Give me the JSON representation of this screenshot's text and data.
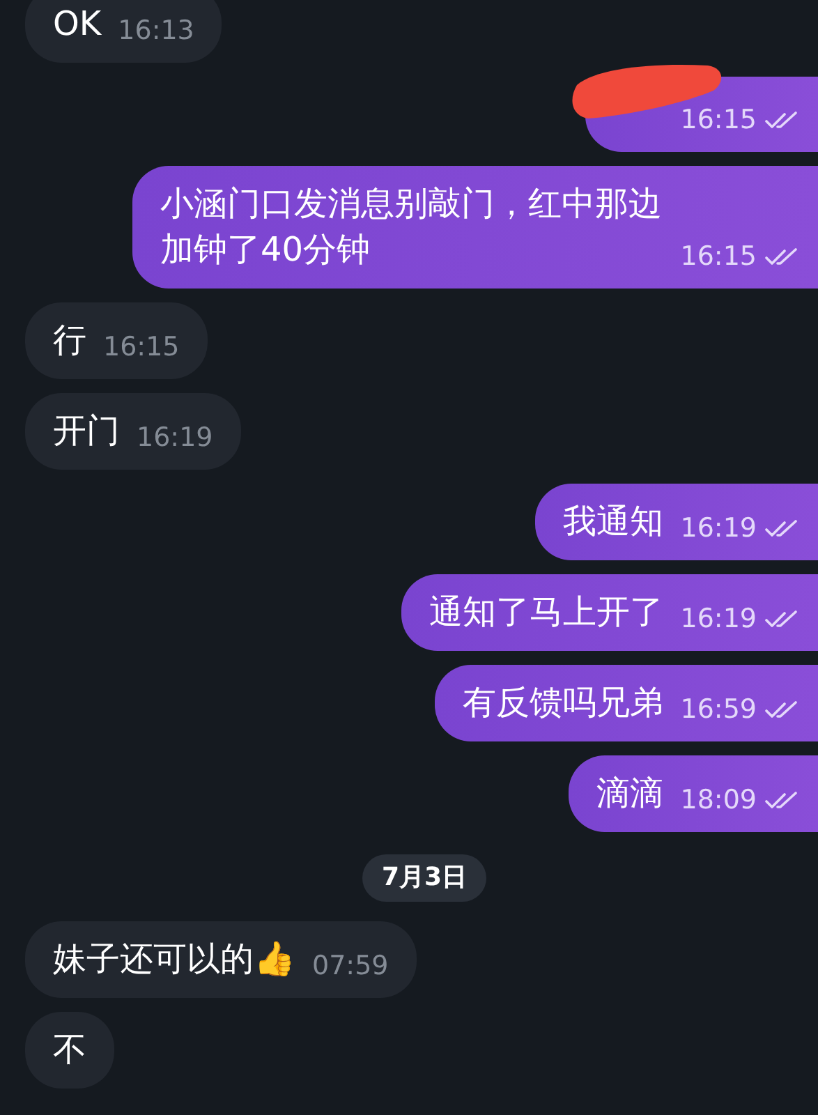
{
  "messages": [
    {
      "kind": "message",
      "outgoing": false,
      "text": "OK",
      "time": "16:13"
    },
    {
      "kind": "redacted",
      "outgoing": true,
      "time": "16:15",
      "read": true
    },
    {
      "kind": "message",
      "outgoing": true,
      "text": "小涵门口发消息别敲门，红中那边加钟了40分钟",
      "time": "16:15",
      "read": true
    },
    {
      "kind": "message",
      "outgoing": false,
      "text": "行",
      "time": "16:15"
    },
    {
      "kind": "message",
      "outgoing": false,
      "text": "开门",
      "time": "16:19"
    },
    {
      "kind": "message",
      "outgoing": true,
      "text": "我通知",
      "time": "16:19",
      "read": true
    },
    {
      "kind": "message",
      "outgoing": true,
      "text": "通知了马上开了",
      "time": "16:19",
      "read": true
    },
    {
      "kind": "message",
      "outgoing": true,
      "text": "有反馈吗兄弟",
      "time": "16:59",
      "read": true
    },
    {
      "kind": "message",
      "outgoing": true,
      "text": "滴滴",
      "time": "18:09",
      "read": true
    },
    {
      "kind": "date",
      "text": "7月3日"
    },
    {
      "kind": "message",
      "outgoing": false,
      "text": "妹子还可以的👍",
      "time": "07:59"
    },
    {
      "kind": "message",
      "outgoing": false,
      "text": "不"
    }
  ]
}
